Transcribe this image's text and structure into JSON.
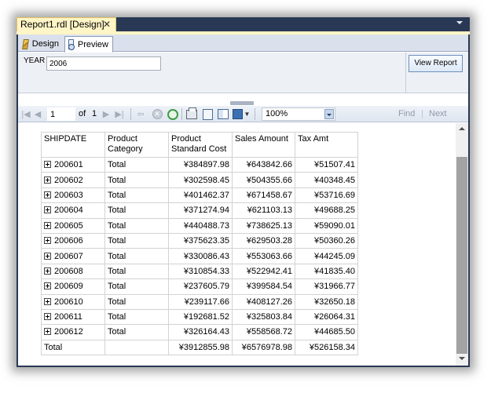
{
  "window": {
    "doc_tab_label": "Report1.rdl [Design]",
    "close_glyph": "✕"
  },
  "view_tabs": [
    {
      "label": "Design",
      "icon": "design-icon",
      "selected": false
    },
    {
      "label": "Preview",
      "icon": "preview-icon",
      "selected": true
    }
  ],
  "parameters": {
    "year_label": "YEAR",
    "year_value": "2006",
    "view_report_label": "View Report"
  },
  "toolbar": {
    "page_value": "1",
    "of_label": "of",
    "page_count": "1",
    "zoom": "100%",
    "find_label": "Find",
    "find_separator": "|",
    "next_label": "Next"
  },
  "report": {
    "columns": [
      "SHIPDATE",
      "Product Category",
      "Product Standard Cost",
      "Sales Amount",
      "Tax Amt"
    ],
    "rows": [
      {
        "shipdate": "200601",
        "category": "Total",
        "cost": "¥384897.98",
        "sales": "¥643842.66",
        "tax": "¥51507.41"
      },
      {
        "shipdate": "200602",
        "category": "Total",
        "cost": "¥302598.45",
        "sales": "¥504355.66",
        "tax": "¥40348.45"
      },
      {
        "shipdate": "200603",
        "category": "Total",
        "cost": "¥401462.37",
        "sales": "¥671458.67",
        "tax": "¥53716.69"
      },
      {
        "shipdate": "200604",
        "category": "Total",
        "cost": "¥371274.94",
        "sales": "¥621103.13",
        "tax": "¥49688.25"
      },
      {
        "shipdate": "200605",
        "category": "Total",
        "cost": "¥440488.73",
        "sales": "¥738625.13",
        "tax": "¥59090.01"
      },
      {
        "shipdate": "200606",
        "category": "Total",
        "cost": "¥375623.35",
        "sales": "¥629503.28",
        "tax": "¥50360.26"
      },
      {
        "shipdate": "200607",
        "category": "Total",
        "cost": "¥330086.43",
        "sales": "¥553063.66",
        "tax": "¥44245.09"
      },
      {
        "shipdate": "200608",
        "category": "Total",
        "cost": "¥310854.33",
        "sales": "¥522942.41",
        "tax": "¥41835.40"
      },
      {
        "shipdate": "200609",
        "category": "Total",
        "cost": "¥237605.79",
        "sales": "¥399584.54",
        "tax": "¥31966.77"
      },
      {
        "shipdate": "200610",
        "category": "Total",
        "cost": "¥239117.66",
        "sales": "¥408127.26",
        "tax": "¥32650.18"
      },
      {
        "shipdate": "200611",
        "category": "Total",
        "cost": "¥192681.52",
        "sales": "¥325803.84",
        "tax": "¥26064.31"
      },
      {
        "shipdate": "200612",
        "category": "Total",
        "cost": "¥326164.43",
        "sales": "¥558568.72",
        "tax": "¥44685.50"
      }
    ],
    "total": {
      "label": "Total",
      "cost": "¥3912855.98",
      "sales": "¥6576978.98",
      "tax": "¥526158.34"
    }
  },
  "colors": {
    "frame": "#293955",
    "active_doc_tab": "#fff5c6",
    "scroll_thumb": "#a3a3a3"
  }
}
